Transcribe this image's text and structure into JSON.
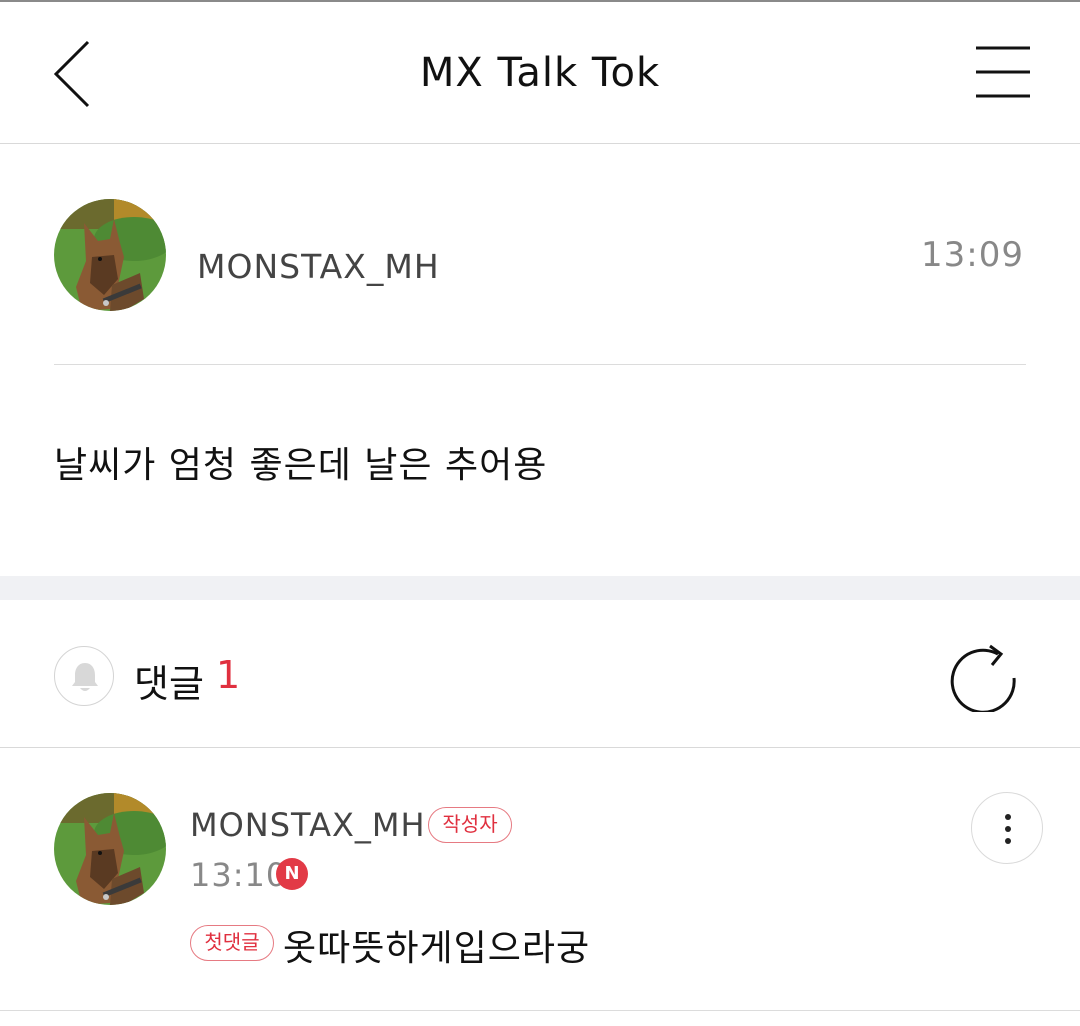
{
  "header": {
    "title": "MX Talk Tok",
    "back_icon": "chevron-left-icon",
    "menu_icon": "hamburger-menu-icon"
  },
  "post": {
    "author": "MONSTAX_MH",
    "time": "13:09",
    "content": "날씨가 엄청 좋은데 날은 추어용"
  },
  "comments_section": {
    "label": "댓글",
    "count": "1",
    "bell_icon": "bell-icon",
    "refresh_icon": "refresh-icon"
  },
  "comments": [
    {
      "author": "MONSTAX_MH",
      "author_badge": "작성자",
      "time": "13:10",
      "new_badge": "N",
      "first_badge": "첫댓글",
      "text": "옷따뜻하게입으라궁"
    }
  ],
  "colors": {
    "accent_red": "#e0303f",
    "divider": "#d9d9d9",
    "section_gap": "#f0f1f4"
  }
}
